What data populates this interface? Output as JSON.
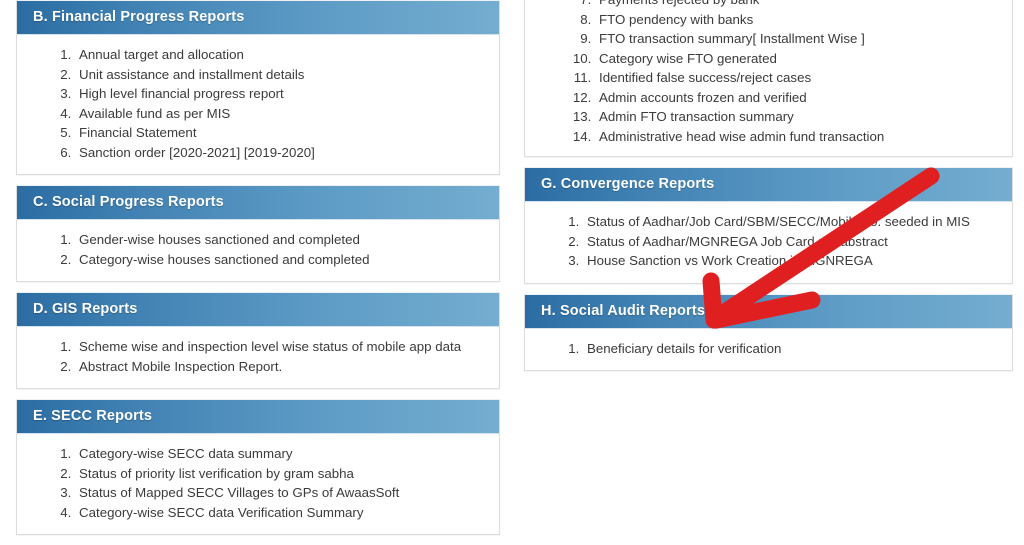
{
  "page": {
    "background_color": "#ffffff",
    "text_color": "#3b3b3b",
    "heading_gradient_from": "#2b6ca3",
    "heading_gradient_to": "#74adcf",
    "annotation_color": "#e02020"
  },
  "left_column": {
    "panels": [
      {
        "id": "financial-progress-reports",
        "heading": "B. Financial Progress Reports",
        "items": [
          "Annual target and allocation",
          "Unit assistance and installment details",
          "High level financial progress report",
          "Available fund as per MIS",
          "Financial Statement",
          "Sanction order [2020-2021] [2019-2020]"
        ]
      },
      {
        "id": "social-progress-reports",
        "heading": "C. Social Progress Reports",
        "items": [
          "Gender-wise houses sanctioned and completed",
          "Category-wise houses sanctioned and completed"
        ]
      },
      {
        "id": "gis-reports",
        "heading": "D. GIS Reports",
        "items": [
          "Scheme wise and inspection level wise status of mobile app data",
          "Abstract Mobile Inspection Report."
        ]
      },
      {
        "id": "secc-reports",
        "heading": "E. SECC Reports",
        "items": [
          "Category-wise SECC data summary",
          "Status of priority list verification by gram sabha",
          "Status of Mapped SECC Villages to GPs of AwaasSoft",
          "Category-wise SECC data Verification Summary"
        ]
      }
    ]
  },
  "right_column": {
    "clipped_panel": {
      "id": "fto-reports-continued",
      "start_number": 7,
      "items": [
        "Payments rejected by bank",
        "FTO pendency with banks",
        "FTO transaction summary[ Installment Wise ]",
        "Category wise FTO generated",
        "Identified false success/reject cases",
        "Admin accounts frozen and verified",
        "Admin FTO transaction summary",
        "Administrative head wise admin fund transaction"
      ]
    },
    "panels": [
      {
        "id": "convergence-reports",
        "heading": "G. Convergence Reports",
        "items": [
          "Status of Aadhar/Job Card/SBM/SECC/Mobile no. seeded in MIS",
          "Status of Aadhar/MGNREGA Job Card no. abstract",
          "House Sanction vs Work Creation in MGNREGA"
        ]
      },
      {
        "id": "social-audit-reports",
        "heading": "H. Social Audit Reports",
        "items": [
          "Beneficiary details for verification"
        ]
      }
    ]
  },
  "annotation": {
    "name": "red-arrow-pointing-to-beneficiary-details",
    "color": "#e02020",
    "points_to": "Beneficiary details for verification"
  }
}
